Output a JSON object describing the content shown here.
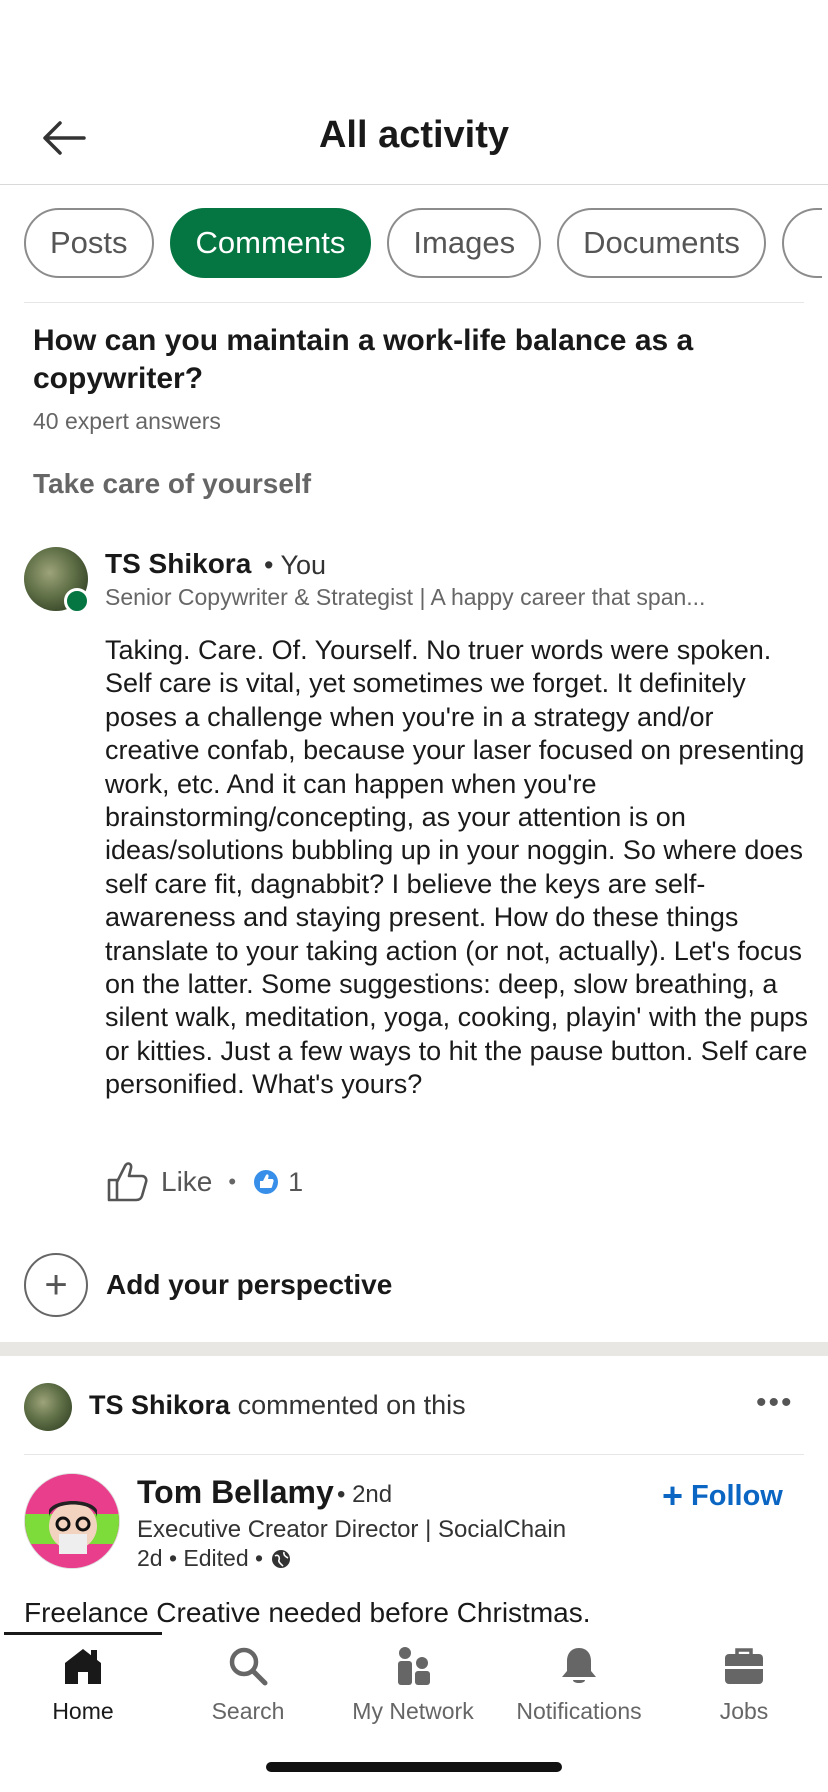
{
  "header": {
    "title": "All activity",
    "back_icon": "arrow-left-icon"
  },
  "filters": [
    "Posts",
    "Comments",
    "Images",
    "Documents"
  ],
  "active_filter": "Comments",
  "question": {
    "title": "How can you maintain a work-life balance as a copywriter?",
    "answers": "40 expert answers",
    "section": "Take care of yourself"
  },
  "comment": {
    "author": "TS Shikora",
    "relation": "• You",
    "headline": "Senior Copywriter & Strategist | A happy career that span...",
    "body": "Taking. Care. Of. Yourself. No truer words were spoken. Self care is vital, yet sometimes we forget. It definitely poses a challenge when you're in a strategy and/or creative confab, because your laser focused on presenting work, etc. And it can happen when you're brainstorming/concepting, as your attention is on ideas/solutions bubbling up in your noggin. So where does self care fit, dagnabbit? I believe the keys are self-awareness and staying present. How do these things translate to your taking action (or not, actually). Let's focus on the latter. Some suggestions: deep, slow breathing, a silent walk, meditation, yoga, cooking, playin' with the pups or kitties. Just a few ways to hit the pause button. Self care personified. What's yours?",
    "like_label": "Like",
    "separator": "•",
    "reaction_count": "1"
  },
  "add_perspective": "Add your perspective",
  "activity": {
    "actor": "TS Shikora",
    "action": "commented on this",
    "more": "•••"
  },
  "post": {
    "author": "Tom Bellamy",
    "degree": "• 2nd",
    "headline": "Executive Creator Director | SocialChain",
    "meta": "2d • Edited •",
    "follow_label": "Follow",
    "follow_plus": "+",
    "text": "Freelance Creative needed before Christmas."
  },
  "nav": {
    "items": [
      {
        "label": "Home",
        "icon": "home-icon"
      },
      {
        "label": "Search",
        "icon": "search-icon"
      },
      {
        "label": "My Network",
        "icon": "people-icon"
      },
      {
        "label": "Notifications",
        "icon": "bell-icon"
      },
      {
        "label": "Jobs",
        "icon": "briefcase-icon"
      }
    ],
    "active": "Home"
  },
  "colors": {
    "accent_green": "#057642",
    "link_blue": "#0a66c2"
  }
}
